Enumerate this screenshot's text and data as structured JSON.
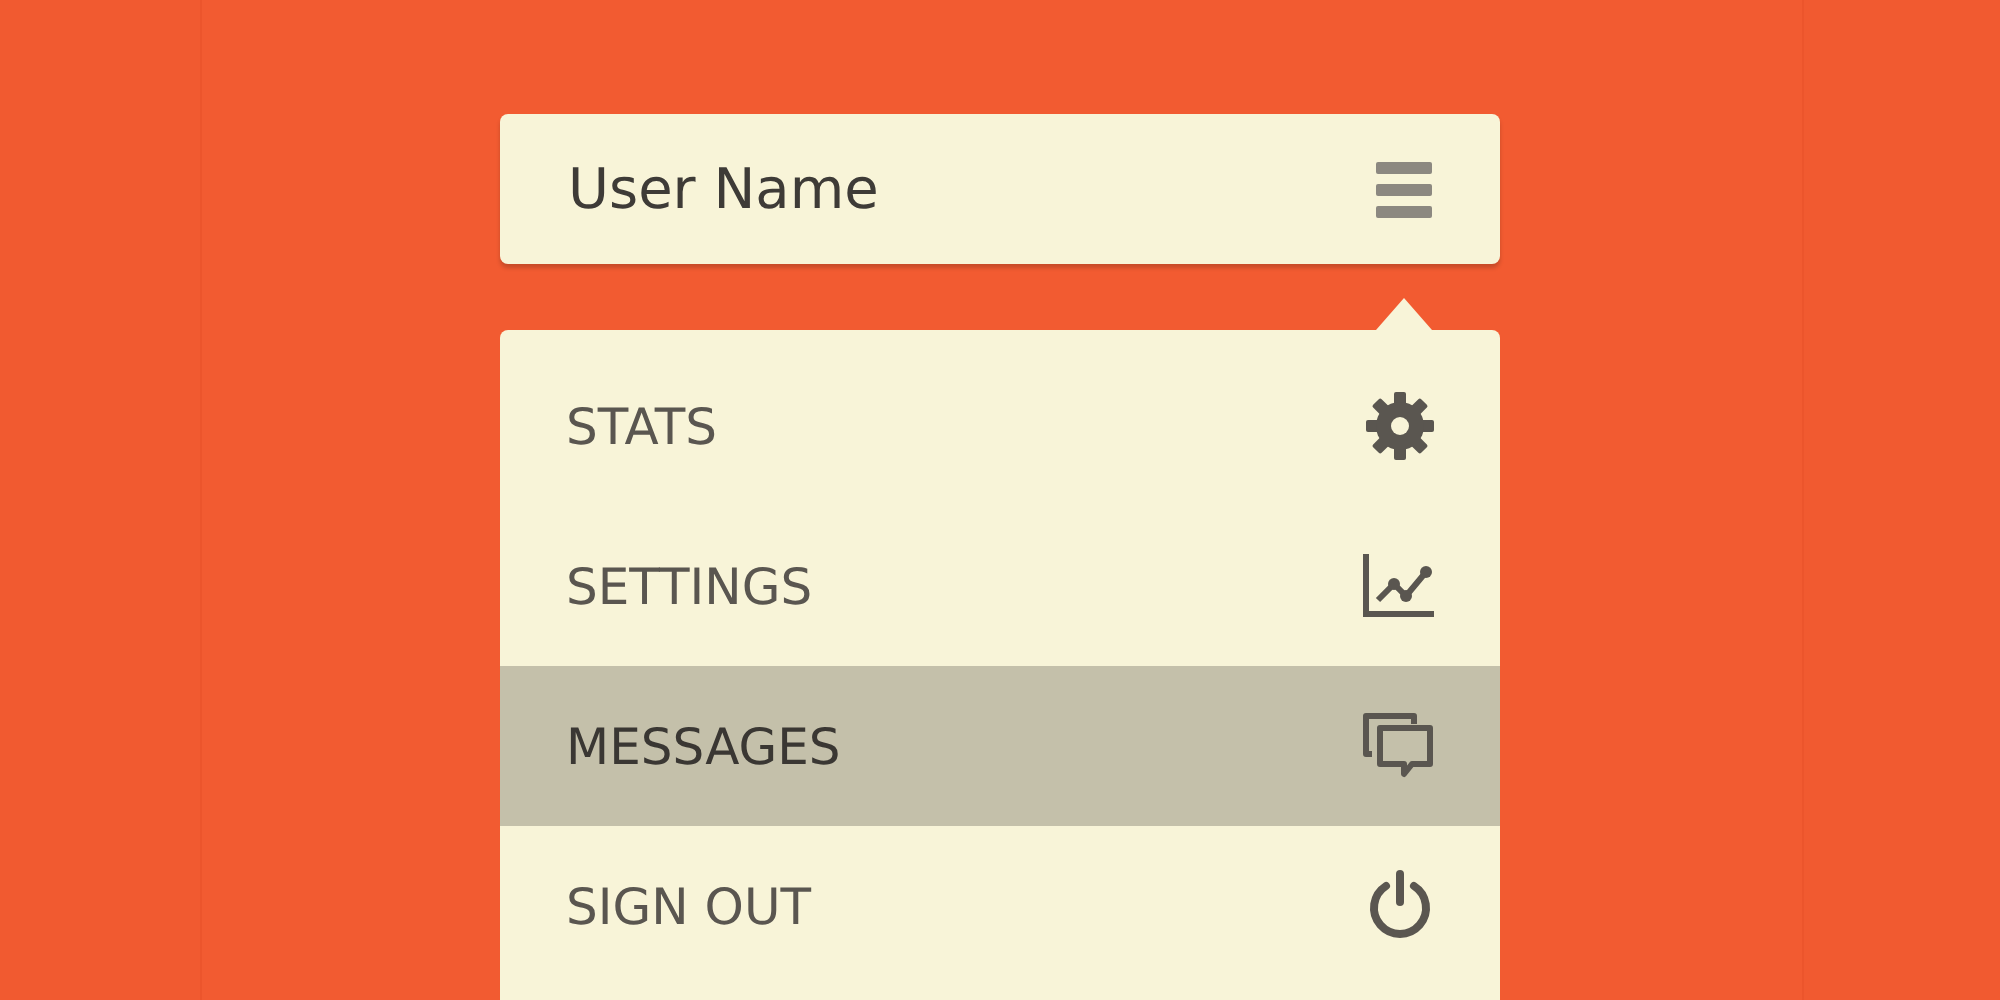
{
  "header": {
    "user_name": "User Name"
  },
  "menu": {
    "items": [
      {
        "label": "STATS",
        "kind": "gear",
        "selected": false
      },
      {
        "label": "SETTINGS",
        "kind": "chart",
        "selected": false
      },
      {
        "label": "MESSAGES",
        "kind": "chat",
        "selected": true
      },
      {
        "label": "SIGN OUT",
        "kind": "power",
        "selected": false
      }
    ]
  }
}
